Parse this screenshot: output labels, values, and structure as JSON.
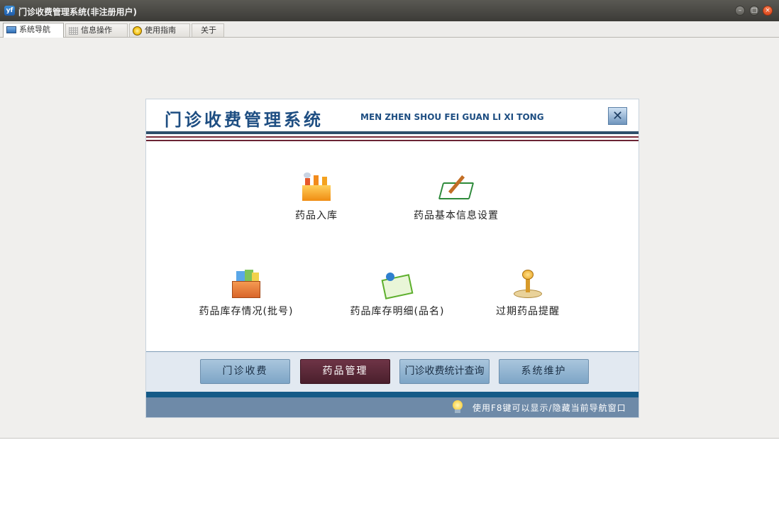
{
  "window": {
    "title": "门诊收费管理系统(非注册用户)",
    "app_icon": "yf"
  },
  "tabs": [
    {
      "label": "系统导航",
      "icon": "monitor-icon",
      "active": true
    },
    {
      "label": "信息操作",
      "icon": "grid-icon",
      "active": false
    },
    {
      "label": "使用指南",
      "icon": "sun-icon",
      "active": false
    },
    {
      "label": "关于",
      "icon": "",
      "active": false
    }
  ],
  "panel": {
    "title": "门诊收费管理系统",
    "subtitle": "MEN ZHEN SHOU FEI GUAN LI XI TONG",
    "close_symbol": "✕"
  },
  "functions": [
    {
      "label": "药品入库",
      "icon": "factory-icon"
    },
    {
      "label": "药品基本信息设置",
      "icon": "book-pen-icon"
    },
    {
      "label": "药品库存情况(批号)",
      "icon": "file-box-icon"
    },
    {
      "label": "药品库存明细(品名)",
      "icon": "open-book-icon"
    },
    {
      "label": "过期药品提醒",
      "icon": "microphone-icon"
    }
  ],
  "modules": [
    {
      "label": "门诊收费",
      "active": false
    },
    {
      "label": "药品管理",
      "active": true
    },
    {
      "label": "门诊收费统计查询",
      "active": false
    },
    {
      "label": "系统维护",
      "active": false
    }
  ],
  "status": {
    "hint": "使用F8键可以显示/隐藏当前导航窗口",
    "icon": "light-bulb-icon"
  },
  "colors": {
    "title_blue": "#1e4e82",
    "active_module": "#5a2636",
    "module_button": "#8fb2d0",
    "status_bar": "#6e8aa8"
  }
}
